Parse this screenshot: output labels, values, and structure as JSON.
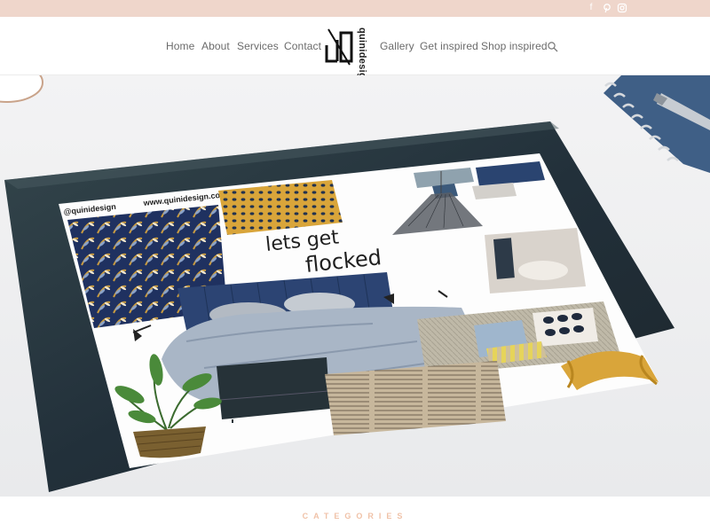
{
  "social": {
    "facebook_icon": "facebook-icon",
    "pinterest_icon": "pinterest-icon",
    "instagram_icon": "instagram-icon"
  },
  "nav": {
    "items": [
      {
        "label": "Home"
      },
      {
        "label": "About"
      },
      {
        "label": "Services"
      },
      {
        "label": "Contact"
      },
      {
        "label": "Gallery"
      },
      {
        "label": "Get inspired"
      },
      {
        "label": "Shop inspired"
      }
    ],
    "logo_text": "quinidesign",
    "search_icon": "search-icon"
  },
  "hero": {
    "handle": "@quinidesign",
    "website": "www.quinidesign.com",
    "headline_line1": "lets get",
    "headline_line2": "flocked"
  },
  "section": {
    "categories_label": "CATEGORIES"
  },
  "colors": {
    "topbar": "#efd6cb",
    "nav_text": "#6b6b6b",
    "accent": "#f0c2a8",
    "tablet": "#263438",
    "navy": "#2c4473",
    "mustard": "#d9a53a"
  }
}
